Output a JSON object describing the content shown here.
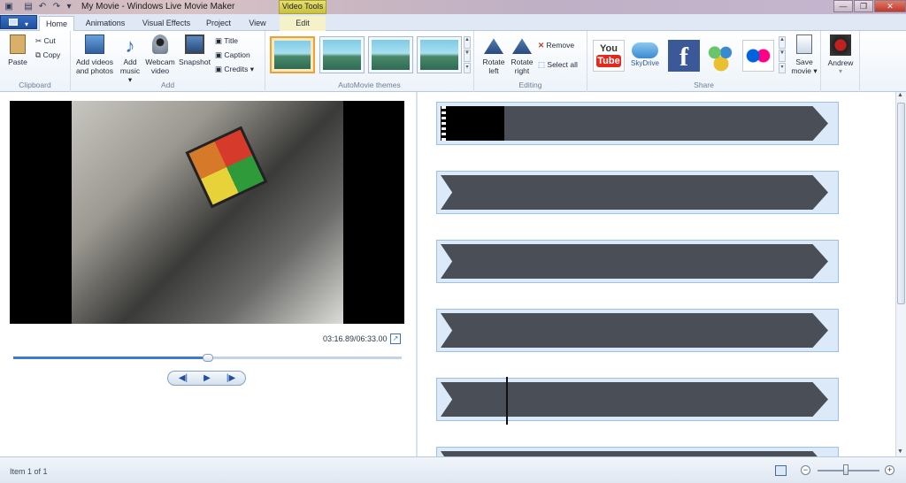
{
  "window": {
    "title": "My Movie - Windows Live Movie Maker",
    "contextual_tab": "Video Tools",
    "minimize": "—",
    "restore": "❐",
    "close": "✕"
  },
  "tabs": [
    {
      "label": "Home"
    },
    {
      "label": "Animations"
    },
    {
      "label": "Visual Effects"
    },
    {
      "label": "Project"
    },
    {
      "label": "View"
    },
    {
      "label": "Edit"
    }
  ],
  "ribbon": {
    "clipboard": {
      "label": "Clipboard",
      "paste": "Paste",
      "cut": "Cut",
      "copy": "Copy"
    },
    "add": {
      "label": "Add",
      "add_videos_1": "Add videos",
      "add_videos_2": "and photos",
      "add_music_1": "Add",
      "add_music_2": "music ▾",
      "webcam_1": "Webcam",
      "webcam_2": "video",
      "snapshot": "Snapshot",
      "title": "Title",
      "caption": "Caption",
      "credits": "Credits ▾"
    },
    "themes": {
      "label": "AutoMovie themes"
    },
    "editing": {
      "label": "Editing",
      "rotate_left_1": "Rotate",
      "rotate_left_2": "left",
      "rotate_right_1": "Rotate",
      "rotate_right_2": "right",
      "remove": "Remove",
      "select_all": "Select all"
    },
    "share": {
      "label": "Share",
      "youtube_1": "You",
      "youtube_2": "Tube",
      "skydrive": "SkyDrive",
      "save_movie_1": "Save",
      "save_movie_2": "movie ▾",
      "user": "Andrew"
    }
  },
  "preview": {
    "timecode": "03:16.89/06:33.00",
    "progress": 0.5
  },
  "status": {
    "text": "Item 1 of 1",
    "zoom": 0.45
  },
  "colors": {
    "accent": "#3e7bd0",
    "clip_strip": "#4a4f57",
    "youtube": "#e02a20",
    "facebook": "#3b5998",
    "selected_theme": "#e9a23a"
  }
}
